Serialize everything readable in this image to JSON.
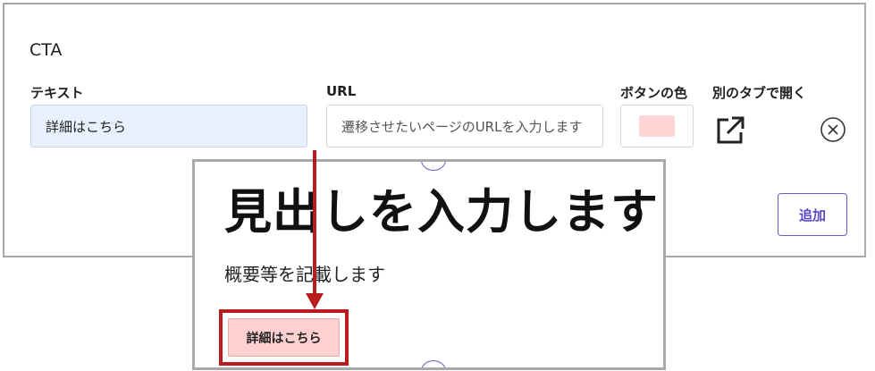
{
  "cta_panel": {
    "title": "CTA",
    "text_label": "テキスト",
    "text_value": "詳細はこちら",
    "url_label": "URL",
    "url_placeholder": "遷移させたいページのURLを入力します",
    "color_label": "ボタンの色",
    "button_color": "#ffd4d4",
    "new_tab_label": "別のタブで開く",
    "new_tab_icon": "external-link-icon",
    "remove_icon": "close-circle-icon",
    "add_label": "追加"
  },
  "preview": {
    "heading": "見出しを入力します",
    "description": "概要等を記載します",
    "cta_label": "詳細はこちら",
    "highlight_color": "#b81c1c"
  },
  "annotation": {
    "arrow_color": "#b81c1c"
  }
}
